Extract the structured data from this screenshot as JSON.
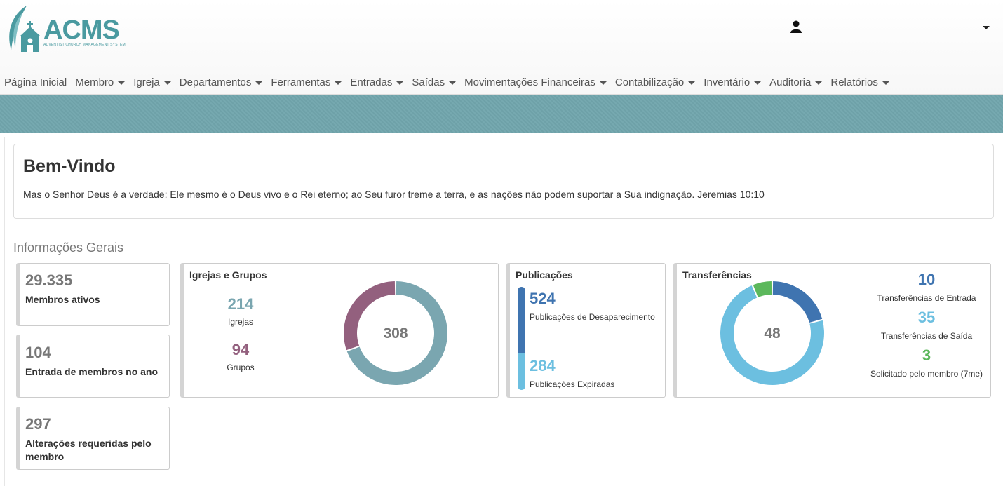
{
  "app": {
    "logo_text": "ACMS",
    "logo_subtitle": "ADVENTIST CHURCH MANAGEMENT SYSTEM"
  },
  "nav": [
    {
      "label": "Página Inicial",
      "dropdown": false
    },
    {
      "label": "Membro",
      "dropdown": true
    },
    {
      "label": "Igreja",
      "dropdown": true
    },
    {
      "label": "Departamentos",
      "dropdown": true
    },
    {
      "label": "Ferramentas",
      "dropdown": true
    },
    {
      "label": "Entradas",
      "dropdown": true
    },
    {
      "label": "Saídas",
      "dropdown": true
    },
    {
      "label": "Movimentações Financeiras",
      "dropdown": true
    },
    {
      "label": "Contabilização",
      "dropdown": true
    },
    {
      "label": "Inventário",
      "dropdown": true
    },
    {
      "label": "Auditoria",
      "dropdown": true
    },
    {
      "label": "Relatórios",
      "dropdown": true
    }
  ],
  "welcome": {
    "title": "Bem-Vindo",
    "verse": "Mas o Senhor Deus é a verdade; Ele mesmo é o Deus vivo e o Rei eterno; ao Seu furor treme a terra, e as nações não podem suportar a Sua indignação. Jeremias 10:10"
  },
  "section_title": "Informações Gerais",
  "stats": [
    {
      "value": "29.335",
      "label": "Membros ativos"
    },
    {
      "value": "104",
      "label": "Entrada de membros no ano"
    },
    {
      "value": "297",
      "label": "Alterações requeridas pelo membro"
    }
  ],
  "churches": {
    "title": "Igrejas e Grupos",
    "total": "308",
    "items": [
      {
        "value": "214",
        "label": "Igrejas",
        "color": "#7aa6b0"
      },
      {
        "value": "94",
        "label": "Grupos",
        "color": "#93607e"
      }
    ]
  },
  "publications": {
    "title": "Publicações",
    "items": [
      {
        "value": "524",
        "label": "Publicações de Desaparecimento",
        "color": "#3f74b0"
      },
      {
        "value": "284",
        "label": "Publicações Expiradas",
        "color": "#6cbfe0"
      }
    ]
  },
  "transfers": {
    "title": "Transferências",
    "total": "48",
    "items": [
      {
        "value": "10",
        "label": "Transferências de Entrada",
        "color": "#3f74b0"
      },
      {
        "value": "35",
        "label": "Transferências de Saída",
        "color": "#6cbfe0"
      },
      {
        "value": "3",
        "label": "Solicitado pelo membro (7me)",
        "color": "#5cb85c"
      }
    ]
  }
}
